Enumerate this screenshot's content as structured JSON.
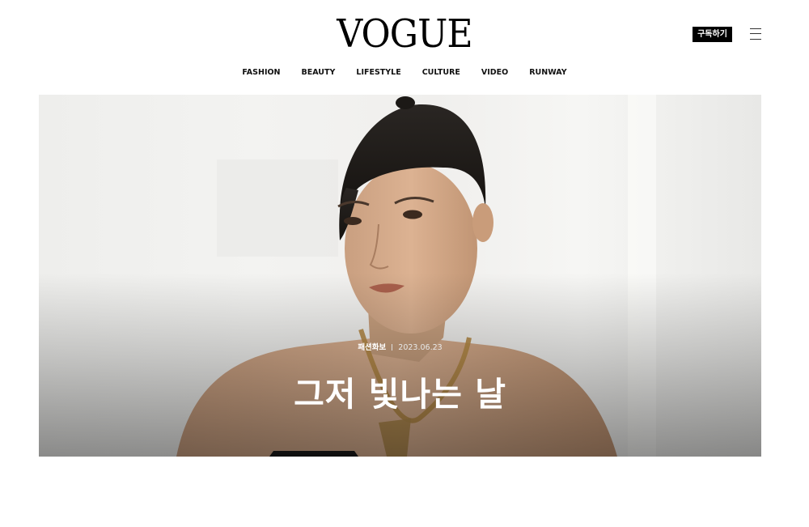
{
  "brand": {
    "logo": "VOGUE"
  },
  "header": {
    "subscribe_label": "구독하기",
    "menu_icon": "hamburger-menu-icon"
  },
  "nav": {
    "items": [
      {
        "label": "FASHION"
      },
      {
        "label": "BEAUTY"
      },
      {
        "label": "LIFESTYLE"
      },
      {
        "label": "CULTURE"
      },
      {
        "label": "VIDEO"
      },
      {
        "label": "RUNWAY"
      }
    ]
  },
  "hero": {
    "category": "패션화보",
    "date": "2023.06.23",
    "title": "그저 빛나는 날",
    "image": "portrait-photo"
  },
  "colors": {
    "subscribe_bg": "#000000",
    "text": "#111111",
    "overlay_text": "#ffffff"
  }
}
